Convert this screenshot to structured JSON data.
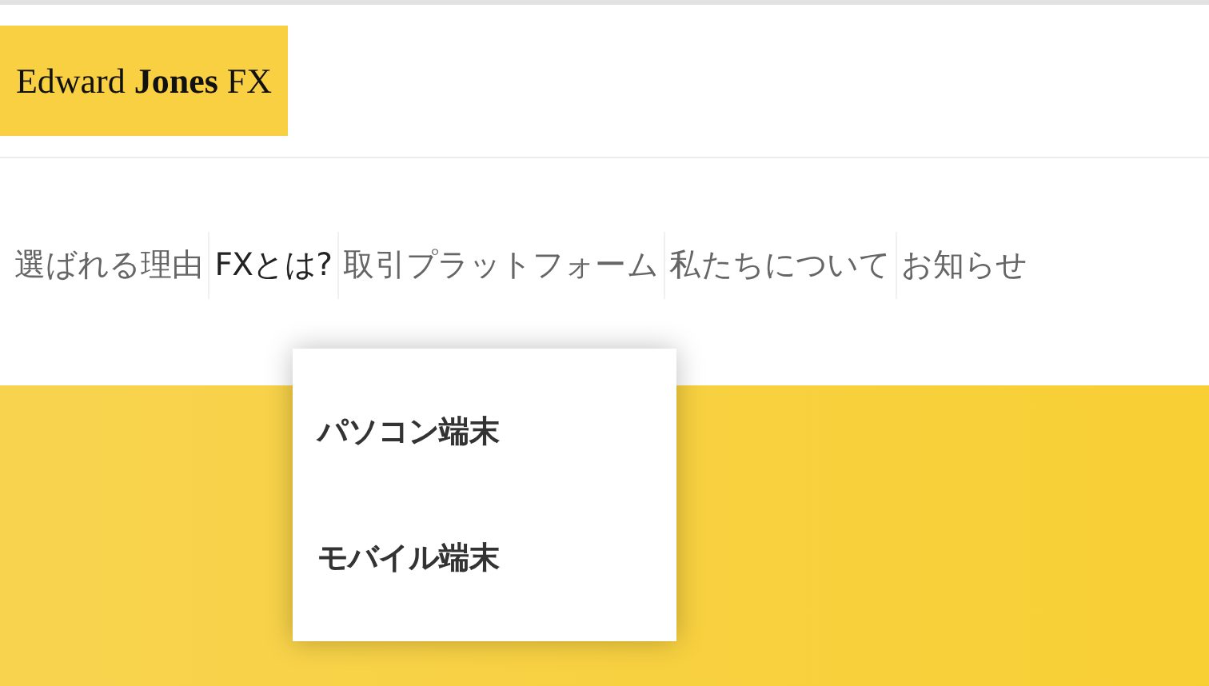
{
  "logo": {
    "text": "Edward **Jones** FX"
  },
  "nav": [
    {
      "label": "選ばれる理由",
      "selected": false
    },
    {
      "label": "FXとは?",
      "selected": true
    },
    {
      "label": "取引プラットフォーム",
      "selected": false,
      "dropdown": [
        "パソコン端末",
        "モバイル端末"
      ]
    },
    {
      "label": "私たちについて",
      "selected": false
    },
    {
      "label": "お知らせ",
      "selected": false
    }
  ]
}
